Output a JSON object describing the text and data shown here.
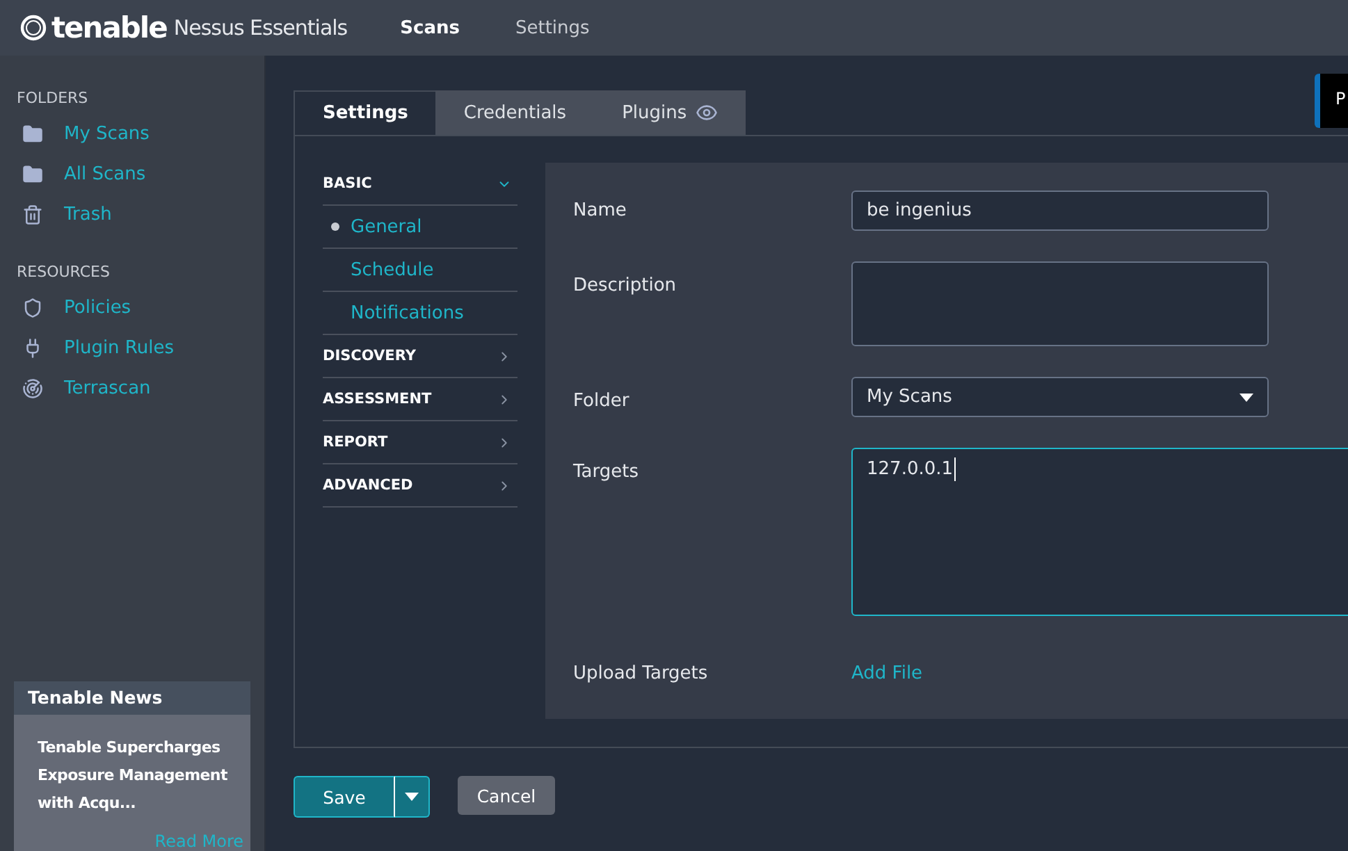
{
  "header": {
    "brand": "tenable",
    "product": "Nessus Essentials",
    "nav": [
      {
        "label": "Scans",
        "selected": true
      },
      {
        "label": "Settings",
        "selected": false
      }
    ]
  },
  "sidebar": {
    "sections": [
      {
        "title": "FOLDERS",
        "items": [
          {
            "label": "My Scans",
            "kind": "folder"
          },
          {
            "label": "All Scans",
            "kind": "folder"
          },
          {
            "label": "Trash",
            "kind": "trash"
          }
        ]
      },
      {
        "title": "RESOURCES",
        "items": [
          {
            "label": "Policies",
            "kind": "shield"
          },
          {
            "label": "Plugin Rules",
            "kind": "plug"
          },
          {
            "label": "Terrascan",
            "kind": "radar"
          }
        ]
      }
    ],
    "news": {
      "title": "Tenable News",
      "headline": "Tenable Supercharges Exposure Management with Acqu...",
      "link": "Read More"
    }
  },
  "toast": {
    "text": "P"
  },
  "tabs": [
    {
      "label": "Settings",
      "selected": true,
      "kind": "plain"
    },
    {
      "label": "Credentials",
      "selected": false,
      "kind": "plain"
    },
    {
      "label": "Plugins",
      "selected": false,
      "kind": "eye"
    }
  ],
  "settings_nav": [
    {
      "label": "BASIC",
      "expanded": true,
      "children": [
        {
          "label": "General",
          "selected": true
        },
        {
          "label": "Schedule",
          "selected": false
        },
        {
          "label": "Notifications",
          "selected": false
        }
      ]
    },
    {
      "label": "DISCOVERY",
      "expanded": false
    },
    {
      "label": "ASSESSMENT",
      "expanded": false
    },
    {
      "label": "REPORT",
      "expanded": false
    },
    {
      "label": "ADVANCED",
      "expanded": false
    }
  ],
  "form": [
    {
      "kind": "text",
      "label": "Name",
      "value": "be ingenius"
    },
    {
      "kind": "textarea",
      "label": "Description"
    },
    {
      "kind": "select",
      "label": "Folder",
      "value": "My Scans"
    },
    {
      "kind": "targets",
      "label": "Targets",
      "value": "127.0.0.1"
    },
    {
      "kind": "file",
      "label": "Upload Targets",
      "link": "Add File"
    }
  ],
  "buttons": {
    "save": "Save",
    "cancel": "Cancel"
  }
}
